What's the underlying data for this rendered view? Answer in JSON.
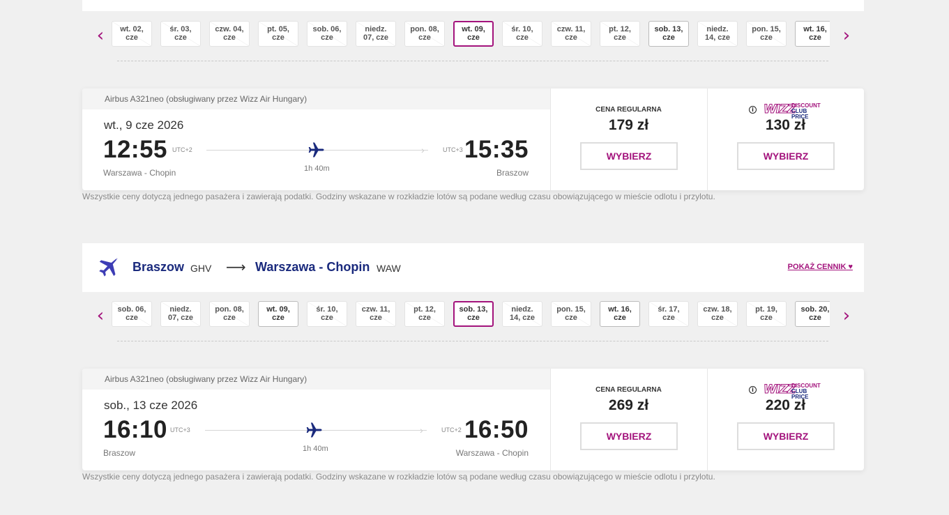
{
  "outbound": {
    "dates": [
      {
        "l1": "wt. 02,",
        "l2": "cze",
        "state": "na"
      },
      {
        "l1": "śr. 03,",
        "l2": "cze",
        "state": "na"
      },
      {
        "l1": "czw. 04,",
        "l2": "cze",
        "state": "na"
      },
      {
        "l1": "pt. 05,",
        "l2": "cze",
        "state": "na"
      },
      {
        "l1": "sob. 06,",
        "l2": "cze",
        "state": "na"
      },
      {
        "l1": "niedz.",
        "l2": "07, cze",
        "state": "na"
      },
      {
        "l1": "pon. 08,",
        "l2": "cze",
        "state": "na"
      },
      {
        "l1": "wt. 09,",
        "l2": "cze",
        "state": "selected"
      },
      {
        "l1": "śr. 10,",
        "l2": "cze",
        "state": "na"
      },
      {
        "l1": "czw. 11,",
        "l2": "cze",
        "state": "na"
      },
      {
        "l1": "pt. 12,",
        "l2": "cze",
        "state": "na"
      },
      {
        "l1": "sob. 13,",
        "l2": "cze",
        "state": "available"
      },
      {
        "l1": "niedz.",
        "l2": "14, cze",
        "state": "na"
      },
      {
        "l1": "pon. 15,",
        "l2": "cze",
        "state": "na"
      },
      {
        "l1": "wt. 16,",
        "l2": "cze",
        "state": "available"
      }
    ],
    "flight": {
      "aircraft": "Airbus A321neo (obsługiwany przez Wizz Air Hungary)",
      "date": "wt., 9 cze 2026",
      "dep_time": "12:55",
      "dep_utc": "UTC+2",
      "arr_time": "15:35",
      "arr_utc": "UTC+3",
      "duration": "1h 40m",
      "dep_city": "Warszawa - Chopin",
      "arr_city": "Braszow",
      "regular_label": "CENA REGULARNA",
      "regular_price": "179 zł",
      "wdc_price": "130 zł",
      "select_label": "WYBIERZ"
    },
    "disclaimer": "Wszystkie ceny dotyczą jednego pasażera i zawierają podatki. Godziny wskazane w rozkładzie lotów są podane według czasu obowiązującego w mieście odlotu i przylotu."
  },
  "return": {
    "header": {
      "origin": "Braszow",
      "origin_code": "GHV",
      "arrow": "⟶",
      "dest": "Warszawa - Chopin",
      "dest_code": "WAW",
      "show_prices": "POKAŻ CENNIK"
    },
    "dates": [
      {
        "l1": "sob. 06,",
        "l2": "cze",
        "state": "na"
      },
      {
        "l1": "niedz.",
        "l2": "07, cze",
        "state": "na"
      },
      {
        "l1": "pon. 08,",
        "l2": "cze",
        "state": "na"
      },
      {
        "l1": "wt. 09,",
        "l2": "cze",
        "state": "available"
      },
      {
        "l1": "śr. 10,",
        "l2": "cze",
        "state": "na"
      },
      {
        "l1": "czw. 11,",
        "l2": "cze",
        "state": "na"
      },
      {
        "l1": "pt. 12,",
        "l2": "cze",
        "state": "na"
      },
      {
        "l1": "sob. 13,",
        "l2": "cze",
        "state": "selected"
      },
      {
        "l1": "niedz.",
        "l2": "14, cze",
        "state": "na"
      },
      {
        "l1": "pon. 15,",
        "l2": "cze",
        "state": "na"
      },
      {
        "l1": "wt. 16,",
        "l2": "cze",
        "state": "available"
      },
      {
        "l1": "śr. 17,",
        "l2": "cze",
        "state": "na"
      },
      {
        "l1": "czw. 18,",
        "l2": "cze",
        "state": "na"
      },
      {
        "l1": "pt. 19,",
        "l2": "cze",
        "state": "na"
      },
      {
        "l1": "sob. 20,",
        "l2": "cze",
        "state": "available"
      }
    ],
    "flight": {
      "aircraft": "Airbus A321neo (obsługiwany przez Wizz Air Hungary)",
      "date": "sob., 13 cze 2026",
      "dep_time": "16:10",
      "dep_utc": "UTC+3",
      "arr_time": "16:50",
      "arr_utc": "UTC+2",
      "duration": "1h 40m",
      "dep_city": "Braszow",
      "arr_city": "Warszawa - Chopin",
      "regular_label": "CENA REGULARNA",
      "regular_price": "269 zł",
      "wdc_price": "220 zł",
      "select_label": "WYBIERZ"
    },
    "disclaimer": "Wszystkie ceny dotyczą jednego pasażera i zawierają podatki. Godziny wskazane w rozkładzie lotów są podane według czasu obowiązującego w mieście odlotu i przylotu."
  },
  "brand": {
    "wdc_logo": "WIZZ",
    "wdc_line1": "DISCOUNT",
    "wdc_line2": "CLUB PRICE",
    "info_glyph": "i",
    "arrow_left": "‹",
    "arrow_right": "›",
    "heart": "♥"
  },
  "colors": {
    "accent": "#a3137c",
    "navy": "#1a2a7d",
    "background": "#f0f0f0"
  }
}
